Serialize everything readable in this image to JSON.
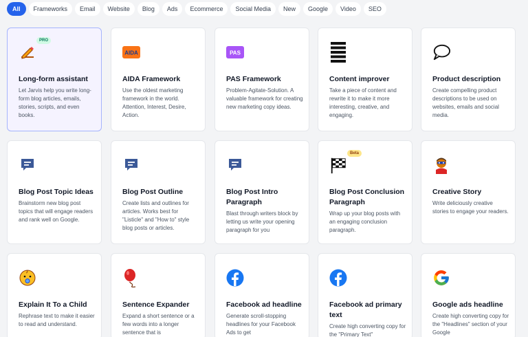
{
  "filters": [
    "All",
    "Frameworks",
    "Email",
    "Website",
    "Blog",
    "Ads",
    "Ecommerce",
    "Social Media",
    "New",
    "Google",
    "Video",
    "SEO"
  ],
  "active_filter": "All",
  "cards": [
    {
      "title": "Long-form assistant",
      "desc": "Let Jarvis help you write long-form blog articles, emails, stories, scripts, and even books.",
      "icon": "pen-icon",
      "badge": "PRO",
      "selected": true
    },
    {
      "title": "AIDA Framework",
      "desc": "Use the oldest marketing framework in the world. Attention, Interest, Desire, Action.",
      "icon": "aida-icon",
      "icon_text": "AIDA"
    },
    {
      "title": "PAS Framework",
      "desc": "Problem-Agitate-Solution. A valuable framework for creating new marketing copy ideas.",
      "icon": "pas-icon",
      "icon_text": "PAS"
    },
    {
      "title": "Content improver",
      "desc": "Take a piece of content and rewrite it to make it more interesting, creative, and engaging.",
      "icon": "lines-icon"
    },
    {
      "title": "Product description",
      "desc": "Create compelling product descriptions to be used on websites, emails and social media.",
      "icon": "speech-bubble-icon"
    },
    {
      "title": "Blog Post Topic Ideas",
      "desc": "Brainstorm new blog post topics that will engage readers and rank well on Google.",
      "icon": "chat-icon"
    },
    {
      "title": "Blog Post Outline",
      "desc": "Create lists and outlines for articles. Works best for \"Listicle\" and \"How to\" style blog posts or articles.",
      "icon": "chat-icon"
    },
    {
      "title": "Blog Post Intro Paragraph",
      "desc": "Blast through writers block by letting us write your opening paragraph for you",
      "icon": "chat-icon"
    },
    {
      "title": "Blog Post Conclusion Paragraph",
      "desc": "Wrap up your blog posts with an engaging conclusion paragraph.",
      "icon": "checkered-flag-icon",
      "badge": "Beta"
    },
    {
      "title": "Creative Story",
      "desc": "Write deliciously creative stories to engage your readers.",
      "icon": "superhero-icon"
    },
    {
      "title": "Explain It To a Child",
      "desc": "Rephrase text to make it easier to read and understand.",
      "icon": "baby-icon"
    },
    {
      "title": "Sentence Expander",
      "desc": "Expand a short sentence or a few words into a longer sentence that is",
      "icon": "balloon-icon"
    },
    {
      "title": "Facebook ad headline",
      "desc": "Generate scroll-stopping headlines for your Facebook Ads to get",
      "icon": "facebook-icon"
    },
    {
      "title": "Facebook ad primary text",
      "desc": "Create high converting copy for the \"Primary Text\"",
      "icon": "facebook-icon"
    },
    {
      "title": "Google ads headline",
      "desc": "Create high converting copy for the \"Headlines\" section of your Google",
      "icon": "google-icon"
    }
  ]
}
